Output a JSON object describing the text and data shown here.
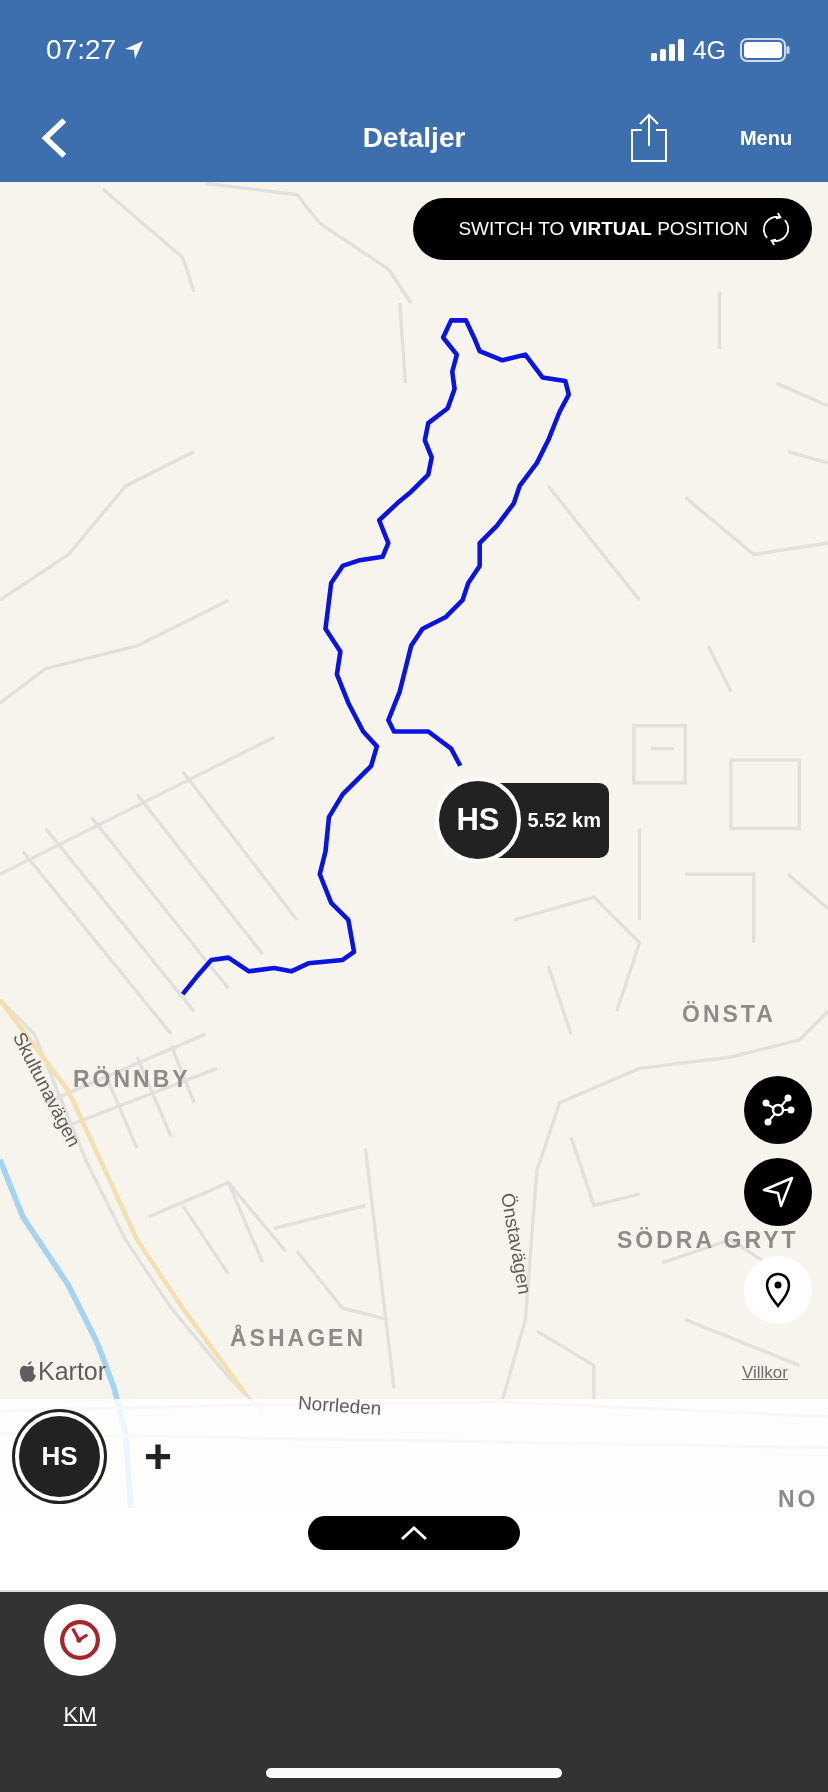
{
  "status_bar": {
    "time": "07:27",
    "network": "4G"
  },
  "nav_bar": {
    "title": "Detaljer",
    "menu": "Menu"
  },
  "virtual_position_button": {
    "label": "SWITCH TO **VIRTUAL** POSITION"
  },
  "map": {
    "labels": [
      {
        "text": "RÖNNBY",
        "kind": "area"
      },
      {
        "text": "ÖNSTA",
        "kind": "area"
      },
      {
        "text": "Skultunavägen",
        "kind": "road"
      },
      {
        "text": "SÖDRA GRYT",
        "kind": "area"
      },
      {
        "text": "Önstavägen",
        "kind": "road"
      },
      {
        "text": "ÅSHAGEN",
        "kind": "area"
      },
      {
        "text": "Norrleden",
        "kind": "road"
      },
      {
        "text": "NO",
        "kind": "area"
      }
    ],
    "marker": {
      "initials": "HS",
      "distance": "5.52 km"
    },
    "attribution": {
      "brand": "Kartor",
      "terms": "Villkor"
    }
  },
  "tray": {
    "participants": [
      {
        "initials": "HS"
      }
    ],
    "add": "+"
  },
  "bottom_bar": {
    "items": [
      {
        "label": "KM"
      }
    ]
  }
}
